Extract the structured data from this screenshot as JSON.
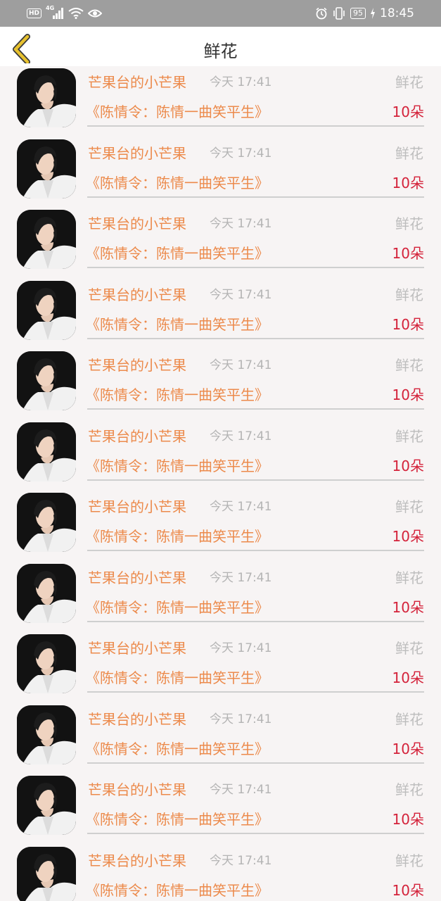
{
  "status_bar": {
    "hd_label": "HD",
    "network_label": "4G",
    "battery_level": "95",
    "time": "18:45"
  },
  "header": {
    "title": "鲜花",
    "back_icon": "chevron-left-icon"
  },
  "colors": {
    "accent_orange": "#ec8a4b",
    "count_red": "#d4223a",
    "back_arrow_yellow": "#e7c12e"
  },
  "items": [
    {
      "sender": "芒果台的小芒果",
      "time": "今天 17:41",
      "gift_type": "鲜花",
      "program": "《陈情令：陈情一曲笑平生》",
      "count": "10朵"
    },
    {
      "sender": "芒果台的小芒果",
      "time": "今天 17:41",
      "gift_type": "鲜花",
      "program": "《陈情令：陈情一曲笑平生》",
      "count": "10朵"
    },
    {
      "sender": "芒果台的小芒果",
      "time": "今天 17:41",
      "gift_type": "鲜花",
      "program": "《陈情令：陈情一曲笑平生》",
      "count": "10朵"
    },
    {
      "sender": "芒果台的小芒果",
      "time": "今天 17:41",
      "gift_type": "鲜花",
      "program": "《陈情令：陈情一曲笑平生》",
      "count": "10朵"
    },
    {
      "sender": "芒果台的小芒果",
      "time": "今天 17:41",
      "gift_type": "鲜花",
      "program": "《陈情令：陈情一曲笑平生》",
      "count": "10朵"
    },
    {
      "sender": "芒果台的小芒果",
      "time": "今天 17:41",
      "gift_type": "鲜花",
      "program": "《陈情令：陈情一曲笑平生》",
      "count": "10朵"
    },
    {
      "sender": "芒果台的小芒果",
      "time": "今天 17:41",
      "gift_type": "鲜花",
      "program": "《陈情令：陈情一曲笑平生》",
      "count": "10朵"
    },
    {
      "sender": "芒果台的小芒果",
      "time": "今天 17:41",
      "gift_type": "鲜花",
      "program": "《陈情令：陈情一曲笑平生》",
      "count": "10朵"
    },
    {
      "sender": "芒果台的小芒果",
      "time": "今天 17:41",
      "gift_type": "鲜花",
      "program": "《陈情令：陈情一曲笑平生》",
      "count": "10朵"
    },
    {
      "sender": "芒果台的小芒果",
      "time": "今天 17:41",
      "gift_type": "鲜花",
      "program": "《陈情令：陈情一曲笑平生》",
      "count": "10朵"
    },
    {
      "sender": "芒果台的小芒果",
      "time": "今天 17:41",
      "gift_type": "鲜花",
      "program": "《陈情令：陈情一曲笑平生》",
      "count": "10朵"
    },
    {
      "sender": "芒果台的小芒果",
      "time": "今天 17:41",
      "gift_type": "鲜花",
      "program": "《陈情令：陈情一曲笑平生》",
      "count": "10朵"
    }
  ]
}
